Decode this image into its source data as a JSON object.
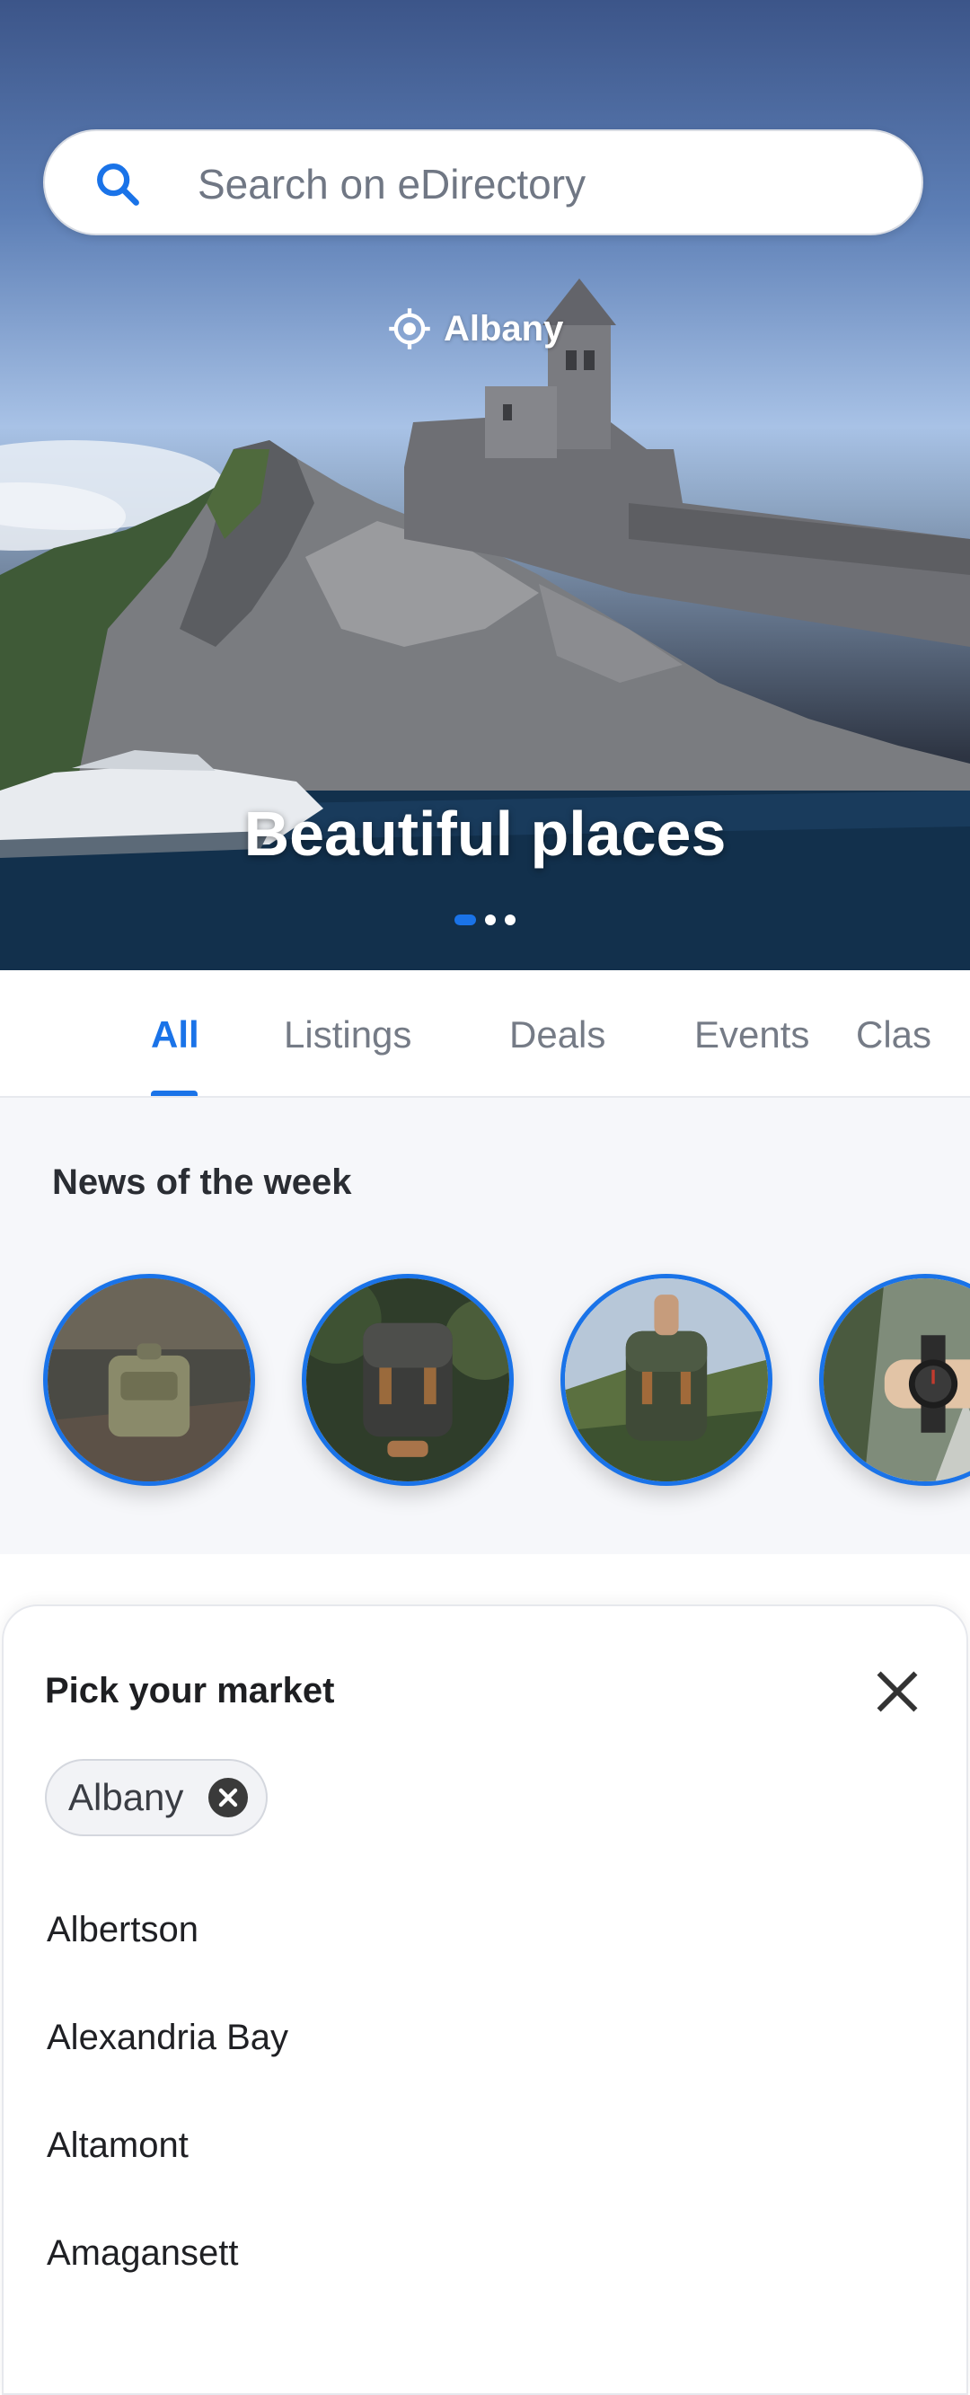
{
  "search": {
    "placeholder": "Search on eDirectory"
  },
  "hero": {
    "location": "Albany",
    "title": "Beautiful places",
    "slides": 3,
    "active_slide": 1
  },
  "tabs": [
    {
      "label": "All",
      "active": true
    },
    {
      "label": "Listings"
    },
    {
      "label": "Deals"
    },
    {
      "label": "Events"
    },
    {
      "label": "Clas"
    }
  ],
  "news": {
    "title": "News of the week",
    "stories": [
      {
        "icon": "backpack-on-log-image"
      },
      {
        "icon": "backpack-image"
      },
      {
        "icon": "backpack-held-image"
      },
      {
        "icon": "wristwatch-image"
      }
    ]
  },
  "market_sheet": {
    "title": "Pick your market",
    "selected_chip": "Albany",
    "items": [
      "Albertson",
      "Alexandria Bay",
      "Altamont",
      "Amagansett"
    ]
  },
  "colors": {
    "accent": "#1a73e8",
    "tab_inactive": "#757b86",
    "news_background": "#f6f7fa"
  }
}
